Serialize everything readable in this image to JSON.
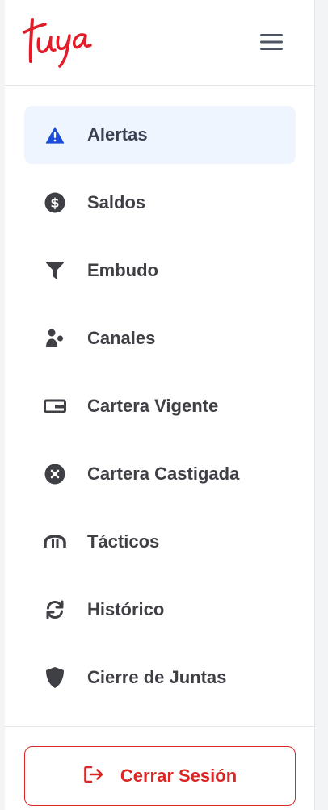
{
  "brand": {
    "logo_text": "tuya",
    "color": "#e11d2a"
  },
  "header": {
    "menu_icon": "hamburger-icon"
  },
  "nav": {
    "items": [
      {
        "label": "Alertas",
        "icon": "alert-triangle-icon",
        "active": true,
        "icon_color": "#1d4ed8"
      },
      {
        "label": "Saldos",
        "icon": "dollar-circle-icon",
        "active": false
      },
      {
        "label": "Embudo",
        "icon": "funnel-icon",
        "active": false
      },
      {
        "label": "Canales",
        "icon": "users-icon",
        "active": false
      },
      {
        "label": "Cartera Vigente",
        "icon": "wallet-icon",
        "active": false
      },
      {
        "label": "Cartera Castigada",
        "icon": "x-circle-icon",
        "active": false
      },
      {
        "label": "Tácticos",
        "icon": "magnet-icon",
        "active": false
      },
      {
        "label": "Histórico",
        "icon": "refresh-icon",
        "active": false
      },
      {
        "label": "Cierre de Juntas",
        "icon": "shield-icon",
        "active": false
      }
    ]
  },
  "footer": {
    "logout_label": "Cerrar Sesión",
    "logout_icon": "logout-icon",
    "logout_color": "#dc2626"
  },
  "colors": {
    "active_bg": "#eff5ff",
    "text": "#3f3f46",
    "icon": "#3f3f46"
  }
}
